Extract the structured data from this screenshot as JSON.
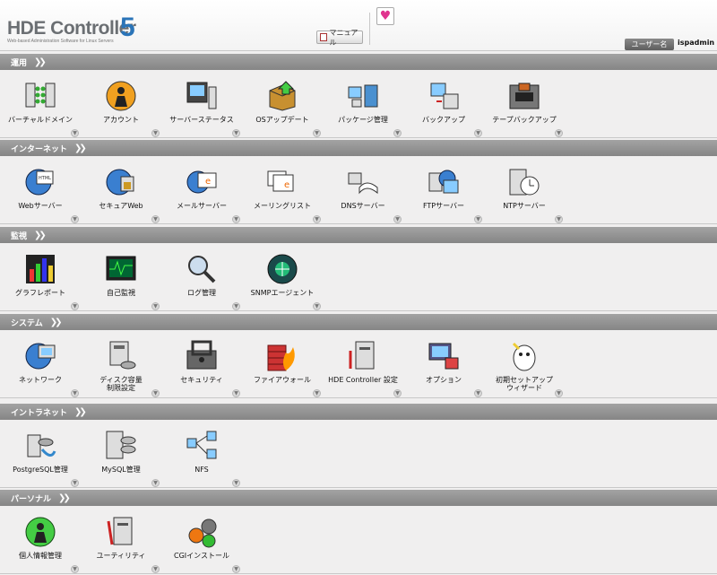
{
  "header": {
    "logo_main": "HDE Controller",
    "logo_version": "5",
    "logo_subtitle": "Web-based Administration Software for Linux Servers",
    "manual_label": "マニュアル",
    "user_label": "ユーザー名",
    "user_name": "ispadmin"
  },
  "sections": [
    {
      "title": "運用",
      "items": [
        {
          "label": "バーチャルドメイン",
          "icon": "virtual-domain-icon"
        },
        {
          "label": "アカウント",
          "icon": "account-icon"
        },
        {
          "label": "サーバーステータス",
          "icon": "server-status-icon"
        },
        {
          "label": "OSアップデート",
          "icon": "os-update-icon"
        },
        {
          "label": "パッケージ管理",
          "icon": "package-icon"
        },
        {
          "label": "バックアップ",
          "icon": "backup-icon"
        },
        {
          "label": "テープバックアップ",
          "icon": "tape-backup-icon"
        }
      ]
    },
    {
      "title": "インターネット",
      "items": [
        {
          "label": "Webサーバー",
          "icon": "web-server-icon"
        },
        {
          "label": "セキュアWeb",
          "icon": "secure-web-icon"
        },
        {
          "label": "メールサーバー",
          "icon": "mail-server-icon"
        },
        {
          "label": "メーリングリスト",
          "icon": "mailing-list-icon"
        },
        {
          "label": "DNSサーバー",
          "icon": "dns-server-icon"
        },
        {
          "label": "FTPサーバー",
          "icon": "ftp-server-icon"
        },
        {
          "label": "NTPサーバー",
          "icon": "ntp-server-icon"
        }
      ]
    },
    {
      "title": "監視",
      "items": [
        {
          "label": "グラフレポート",
          "icon": "graph-report-icon"
        },
        {
          "label": "自己監視",
          "icon": "self-monitor-icon"
        },
        {
          "label": "ログ管理",
          "icon": "log-icon"
        },
        {
          "label": "SNMPエージェント",
          "icon": "snmp-agent-icon"
        }
      ]
    },
    {
      "title": "システム",
      "items": [
        {
          "label": "ネットワーク",
          "icon": "network-icon"
        },
        {
          "label": "ディスク容量\n制限設定",
          "icon": "disk-quota-icon"
        },
        {
          "label": "セキュリティ",
          "icon": "security-icon"
        },
        {
          "label": "ファイアウォール",
          "icon": "firewall-icon"
        },
        {
          "label": "HDE Controller 設定",
          "icon": "controller-settings-icon"
        },
        {
          "label": "オプション",
          "icon": "options-icon"
        },
        {
          "label": "初期セットアップ\nウィザード",
          "icon": "setup-wizard-icon"
        }
      ]
    },
    {
      "title": "イントラネット",
      "items": [
        {
          "label": "PostgreSQL管理",
          "icon": "postgresql-icon"
        },
        {
          "label": "MySQL管理",
          "icon": "mysql-icon"
        },
        {
          "label": "NFS",
          "icon": "nfs-icon"
        }
      ]
    },
    {
      "title": "パーソナル",
      "items": [
        {
          "label": "個人情報管理",
          "icon": "personal-info-icon"
        },
        {
          "label": "ユーティリティ",
          "icon": "utility-icon"
        },
        {
          "label": "CGIインストール",
          "icon": "cgi-install-icon"
        }
      ]
    }
  ]
}
